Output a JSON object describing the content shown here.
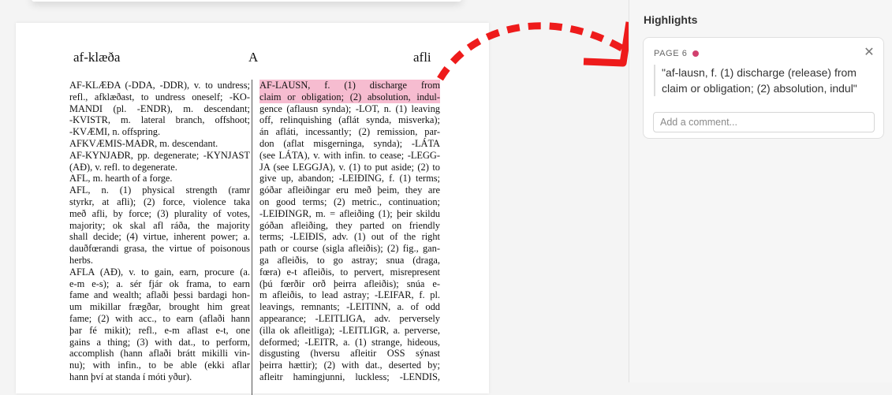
{
  "document": {
    "running_head": {
      "left": "af-klæða",
      "center": "A",
      "right": "afli"
    },
    "left_column": [
      "AF-KLÆÐA (-DDA, -DDR), v. to undress;",
      "refl., afklæðast, to undress oneself; -KO-",
      "MANDI (pl. -ENDR), m. descendant;",
      "-KVISTR, m. lateral branch, offshoot;",
      "-KVÆMI, n. offspring.",
      "AFKVÆMIS-MAÐR, m. descendant.",
      "AF-KYNJAÐR, pp. degenerate; -KYNJAST",
      "(AÐ), v. refl. to degenerate.",
      "AFL, m. hearth of a forge.",
      "AFL, n. (1) physical strength (ramr",
      "styrkr, at afli); (2) force, violence taka",
      "með afli, by force; (3) plurality of votes,",
      "majority; ok skal afl ráða, the majority",
      "shall decide; (4) virtue, inherent power; a.",
      "dauðfœrandi grasa, the virtue of poisonous",
      "herbs.",
      "AFLA (AÐ), v. to gain, earn, procure (a.",
      "e-m e-s); a. sér fjár ok frama, to earn",
      "fame and wealth; aflaði þessi bardagi hon-",
      "um mikillar frægðar, brought him great",
      "fame; (2) with acc., to earn (aflaði hann",
      "þar fé mikit); refl., e-m aflast e-t, one",
      "gains a thing; (3) with dat., to perform,",
      "accomplish (hann aflaði brátt mikilli vin-",
      "nu); with infin., to be able (ekki aflar",
      "hann því at standa í móti yður)."
    ],
    "right_column_highlight": [
      "AF-LAUSN, f. (1) discharge from",
      "claim or obligation; (2) absolution, indul-"
    ],
    "right_column": [
      "gence (aflausn synda); -LOT, n. (1) leaving",
      "off, relinquishing (aflát synda, misverka);",
      "án afláti, incessantly; (2) remission, par-",
      "don (aflat misgerninga, synda); -LÁTA",
      "(see LÁTA), v. with infin. to cease; -LEGG-",
      "JA (see LEGGJA), v. (1) to put aside; (2) to",
      "give up, abandon; -LEIÐING, f. (1) terms;",
      "góðar afleiðingar eru með þeim, they are",
      "on good terms; (2) metric., continuation;",
      "-LEIÐINGR, m. = afleiðing (1); þeir skildu",
      "góðan afleiðing, they parted on friendly",
      "terms; -LEIÐIS, adv. (1) out of the right",
      "path or course (sigla afleiðis); (2) fig., gan-",
      "ga afleiðis, to go astray; snua (draga,",
      "fœra) e-t afleiðis, to pervert, misrepresent",
      "(þú fœrðir orð þeirra afleiðis); snúa e-",
      "m afleiðis, to lead astray; -LEIFAR, f. pl.",
      "leavings, remnants; -LEITINN, a. of odd",
      "appearance; -LEITLIGA, adv. perversely",
      "(illa ok afleitliga); -LEITLIGR, a. perverse,",
      "deformed; -LEITR, a. (1) strange, hideous,",
      "disgusting (hversu afleitir OSS sýnast",
      "þeirra hættir); (2) with dat., deserted by;",
      "afleitr hamingjunni, luckless; -LENDIS,"
    ]
  },
  "highlights_panel": {
    "title": "Highlights",
    "cards": [
      {
        "page": "PAGE 6",
        "quote": "\"af-lausn, f. (1) discharge (release) from claim or obligation; (2) absolution, indul\"",
        "comment_placeholder": "Add a comment...",
        "dot_color": "#d1406e"
      }
    ]
  },
  "colors": {
    "highlight": "#f6bcd0",
    "arrow": "#ee1b1b",
    "accent": "#d1406e"
  },
  "icons": {
    "close": "close-icon",
    "arrow": "curved-dashed-arrow-icon"
  }
}
